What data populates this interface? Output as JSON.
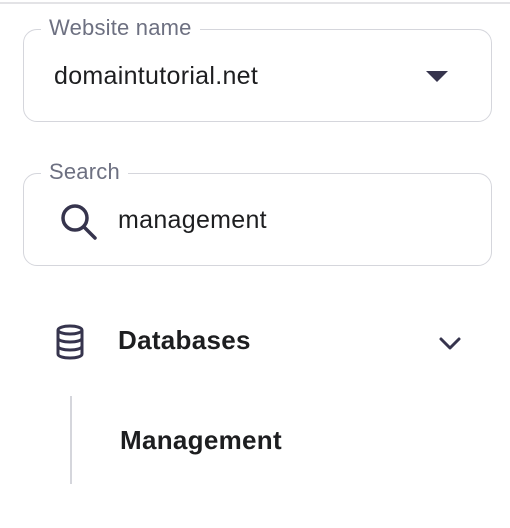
{
  "website_select": {
    "legend": "Website name",
    "value": "domaintutorial.net",
    "caret_icon": "caret-down-icon"
  },
  "search": {
    "legend": "Search",
    "value": "management",
    "icon": "search-icon"
  },
  "nav": {
    "group": {
      "label": "Databases",
      "icon": "database-icon",
      "expand_icon": "chevron-down-icon",
      "expanded": true,
      "items": [
        {
          "label": "Management"
        }
      ]
    }
  },
  "colors": {
    "text": "#1d1e20",
    "muted": "#6d7081",
    "border": "#d5d6dc",
    "icon": "#36344d"
  }
}
